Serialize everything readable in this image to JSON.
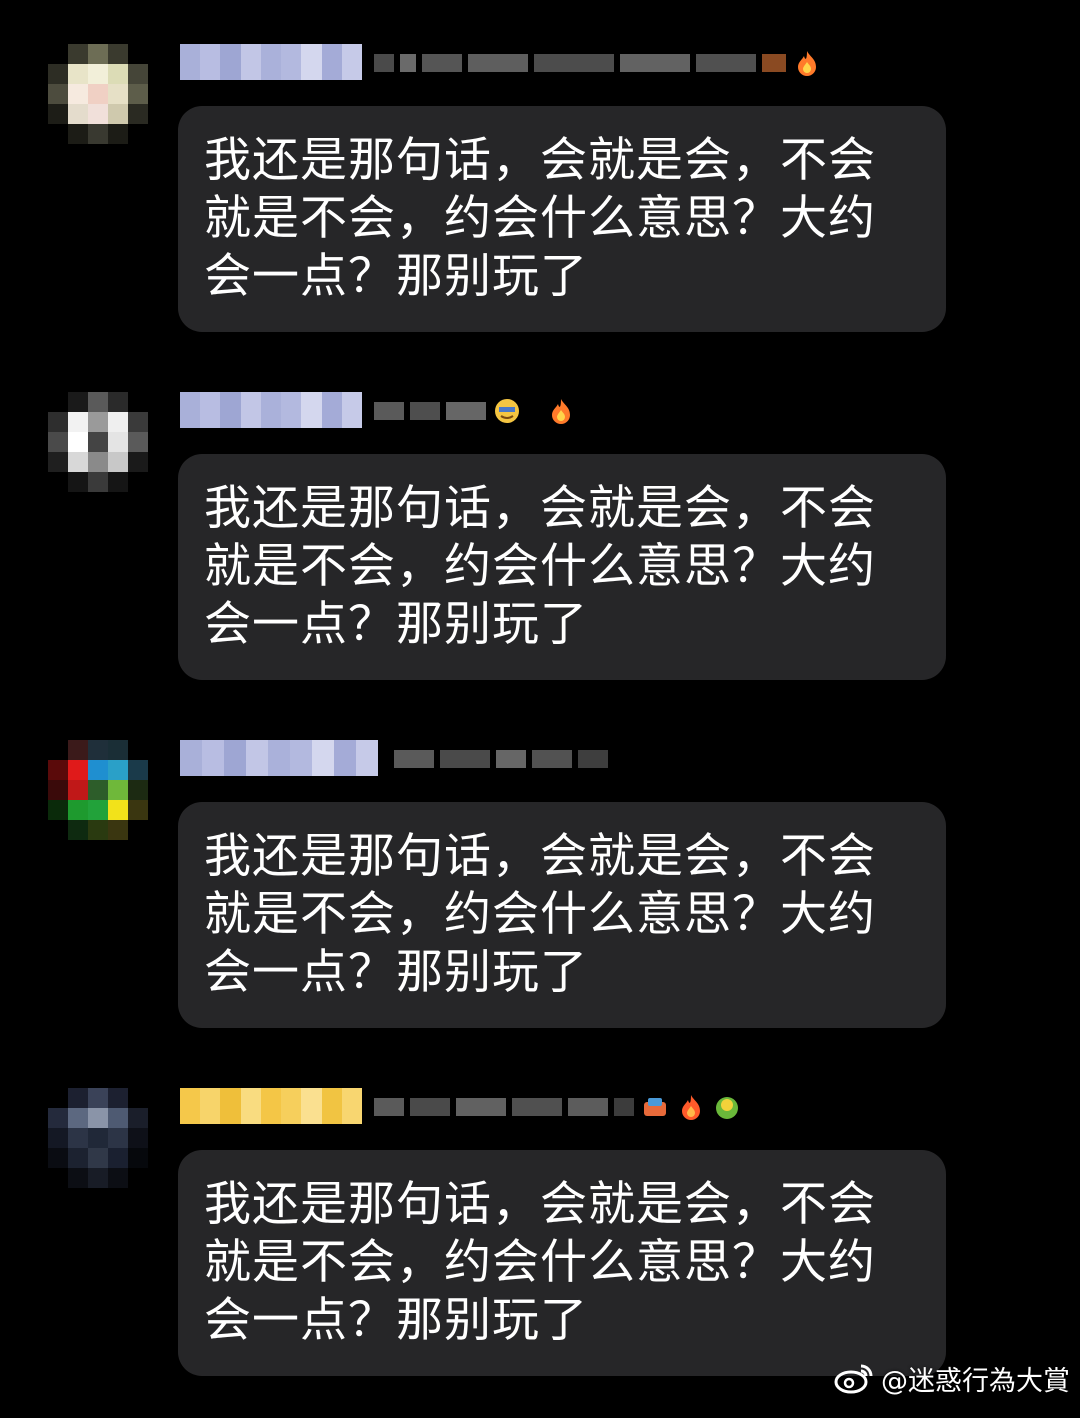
{
  "comments": [
    {
      "avatar_description": "pixelated-avatar",
      "badge_color": "#a9b0d9",
      "message": "我还是那句话，会就是会，不会就是不会，约会什么意思？大约会一点？那别玩了"
    },
    {
      "avatar_description": "pixelated-avatar",
      "badge_color": "#a9b0d9",
      "message": "我还是那句话，会就是会，不会就是不会，约会什么意思？大约会一点？那别玩了"
    },
    {
      "avatar_description": "pixelated-avatar",
      "badge_color": "#a9b0d9",
      "message": "我还是那句话，会就是会，不会就是不会，约会什么意思？大约会一点？那别玩了"
    },
    {
      "avatar_description": "pixelated-avatar",
      "badge_color": "#f5c84a",
      "message": "我还是那句话，会就是会，不会就是不会，约会什么意思？大约会一点？那别玩了"
    }
  ],
  "watermark": {
    "icon": "weibo-icon",
    "text": "@迷惑行為大賞"
  },
  "colors": {
    "background": "#000000",
    "bubble": "#262628",
    "text": "#ffffff"
  }
}
